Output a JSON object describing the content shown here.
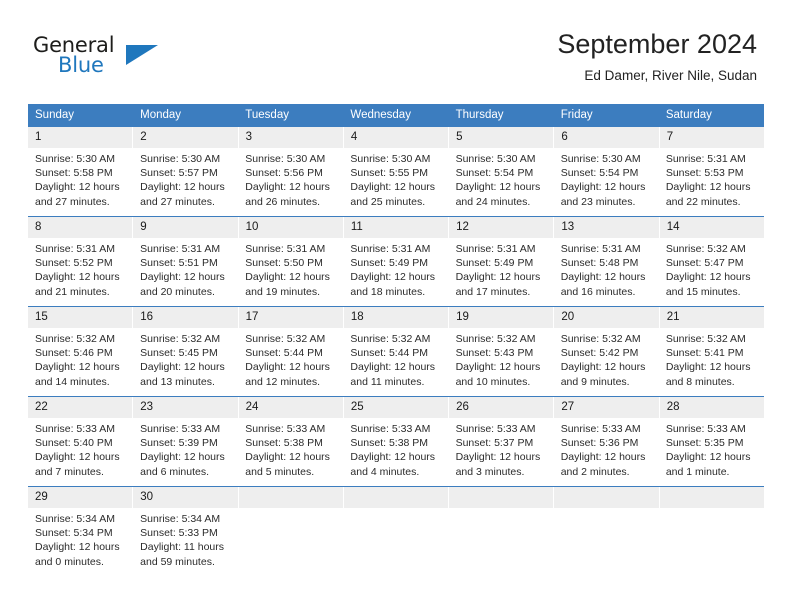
{
  "logo": {
    "word1": "General",
    "word2": "Blue",
    "triangle_color": "#1f77bd"
  },
  "header": {
    "title": "September 2024",
    "subtitle": "Ed Damer, River Nile, Sudan"
  },
  "theme": {
    "header_blue": "#3c7dbf",
    "daynum_band": "#eeeeee",
    "text": "#1a1a1a"
  },
  "weekdays": [
    "Sunday",
    "Monday",
    "Tuesday",
    "Wednesday",
    "Thursday",
    "Friday",
    "Saturday"
  ],
  "weeks": [
    {
      "days": [
        {
          "num": "1",
          "sunrise": "Sunrise: 5:30 AM",
          "sunset": "Sunset: 5:58 PM",
          "daylight1": "Daylight: 12 hours",
          "daylight2": "and 27 minutes."
        },
        {
          "num": "2",
          "sunrise": "Sunrise: 5:30 AM",
          "sunset": "Sunset: 5:57 PM",
          "daylight1": "Daylight: 12 hours",
          "daylight2": "and 27 minutes."
        },
        {
          "num": "3",
          "sunrise": "Sunrise: 5:30 AM",
          "sunset": "Sunset: 5:56 PM",
          "daylight1": "Daylight: 12 hours",
          "daylight2": "and 26 minutes."
        },
        {
          "num": "4",
          "sunrise": "Sunrise: 5:30 AM",
          "sunset": "Sunset: 5:55 PM",
          "daylight1": "Daylight: 12 hours",
          "daylight2": "and 25 minutes."
        },
        {
          "num": "5",
          "sunrise": "Sunrise: 5:30 AM",
          "sunset": "Sunset: 5:54 PM",
          "daylight1": "Daylight: 12 hours",
          "daylight2": "and 24 minutes."
        },
        {
          "num": "6",
          "sunrise": "Sunrise: 5:30 AM",
          "sunset": "Sunset: 5:54 PM",
          "daylight1": "Daylight: 12 hours",
          "daylight2": "and 23 minutes."
        },
        {
          "num": "7",
          "sunrise": "Sunrise: 5:31 AM",
          "sunset": "Sunset: 5:53 PM",
          "daylight1": "Daylight: 12 hours",
          "daylight2": "and 22 minutes."
        }
      ]
    },
    {
      "days": [
        {
          "num": "8",
          "sunrise": "Sunrise: 5:31 AM",
          "sunset": "Sunset: 5:52 PM",
          "daylight1": "Daylight: 12 hours",
          "daylight2": "and 21 minutes."
        },
        {
          "num": "9",
          "sunrise": "Sunrise: 5:31 AM",
          "sunset": "Sunset: 5:51 PM",
          "daylight1": "Daylight: 12 hours",
          "daylight2": "and 20 minutes."
        },
        {
          "num": "10",
          "sunrise": "Sunrise: 5:31 AM",
          "sunset": "Sunset: 5:50 PM",
          "daylight1": "Daylight: 12 hours",
          "daylight2": "and 19 minutes."
        },
        {
          "num": "11",
          "sunrise": "Sunrise: 5:31 AM",
          "sunset": "Sunset: 5:49 PM",
          "daylight1": "Daylight: 12 hours",
          "daylight2": "and 18 minutes."
        },
        {
          "num": "12",
          "sunrise": "Sunrise: 5:31 AM",
          "sunset": "Sunset: 5:49 PM",
          "daylight1": "Daylight: 12 hours",
          "daylight2": "and 17 minutes."
        },
        {
          "num": "13",
          "sunrise": "Sunrise: 5:31 AM",
          "sunset": "Sunset: 5:48 PM",
          "daylight1": "Daylight: 12 hours",
          "daylight2": "and 16 minutes."
        },
        {
          "num": "14",
          "sunrise": "Sunrise: 5:32 AM",
          "sunset": "Sunset: 5:47 PM",
          "daylight1": "Daylight: 12 hours",
          "daylight2": "and 15 minutes."
        }
      ]
    },
    {
      "days": [
        {
          "num": "15",
          "sunrise": "Sunrise: 5:32 AM",
          "sunset": "Sunset: 5:46 PM",
          "daylight1": "Daylight: 12 hours",
          "daylight2": "and 14 minutes."
        },
        {
          "num": "16",
          "sunrise": "Sunrise: 5:32 AM",
          "sunset": "Sunset: 5:45 PM",
          "daylight1": "Daylight: 12 hours",
          "daylight2": "and 13 minutes."
        },
        {
          "num": "17",
          "sunrise": "Sunrise: 5:32 AM",
          "sunset": "Sunset: 5:44 PM",
          "daylight1": "Daylight: 12 hours",
          "daylight2": "and 12 minutes."
        },
        {
          "num": "18",
          "sunrise": "Sunrise: 5:32 AM",
          "sunset": "Sunset: 5:44 PM",
          "daylight1": "Daylight: 12 hours",
          "daylight2": "and 11 minutes."
        },
        {
          "num": "19",
          "sunrise": "Sunrise: 5:32 AM",
          "sunset": "Sunset: 5:43 PM",
          "daylight1": "Daylight: 12 hours",
          "daylight2": "and 10 minutes."
        },
        {
          "num": "20",
          "sunrise": "Sunrise: 5:32 AM",
          "sunset": "Sunset: 5:42 PM",
          "daylight1": "Daylight: 12 hours",
          "daylight2": "and 9 minutes."
        },
        {
          "num": "21",
          "sunrise": "Sunrise: 5:32 AM",
          "sunset": "Sunset: 5:41 PM",
          "daylight1": "Daylight: 12 hours",
          "daylight2": "and 8 minutes."
        }
      ]
    },
    {
      "days": [
        {
          "num": "22",
          "sunrise": "Sunrise: 5:33 AM",
          "sunset": "Sunset: 5:40 PM",
          "daylight1": "Daylight: 12 hours",
          "daylight2": "and 7 minutes."
        },
        {
          "num": "23",
          "sunrise": "Sunrise: 5:33 AM",
          "sunset": "Sunset: 5:39 PM",
          "daylight1": "Daylight: 12 hours",
          "daylight2": "and 6 minutes."
        },
        {
          "num": "24",
          "sunrise": "Sunrise: 5:33 AM",
          "sunset": "Sunset: 5:38 PM",
          "daylight1": "Daylight: 12 hours",
          "daylight2": "and 5 minutes."
        },
        {
          "num": "25",
          "sunrise": "Sunrise: 5:33 AM",
          "sunset": "Sunset: 5:38 PM",
          "daylight1": "Daylight: 12 hours",
          "daylight2": "and 4 minutes."
        },
        {
          "num": "26",
          "sunrise": "Sunrise: 5:33 AM",
          "sunset": "Sunset: 5:37 PM",
          "daylight1": "Daylight: 12 hours",
          "daylight2": "and 3 minutes."
        },
        {
          "num": "27",
          "sunrise": "Sunrise: 5:33 AM",
          "sunset": "Sunset: 5:36 PM",
          "daylight1": "Daylight: 12 hours",
          "daylight2": "and 2 minutes."
        },
        {
          "num": "28",
          "sunrise": "Sunrise: 5:33 AM",
          "sunset": "Sunset: 5:35 PM",
          "daylight1": "Daylight: 12 hours",
          "daylight2": "and 1 minute."
        }
      ]
    },
    {
      "days": [
        {
          "num": "29",
          "sunrise": "Sunrise: 5:34 AM",
          "sunset": "Sunset: 5:34 PM",
          "daylight1": "Daylight: 12 hours",
          "daylight2": "and 0 minutes."
        },
        {
          "num": "30",
          "sunrise": "Sunrise: 5:34 AM",
          "sunset": "Sunset: 5:33 PM",
          "daylight1": "Daylight: 11 hours",
          "daylight2": "and 59 minutes."
        },
        {
          "num": "",
          "sunrise": "",
          "sunset": "",
          "daylight1": "",
          "daylight2": ""
        },
        {
          "num": "",
          "sunrise": "",
          "sunset": "",
          "daylight1": "",
          "daylight2": ""
        },
        {
          "num": "",
          "sunrise": "",
          "sunset": "",
          "daylight1": "",
          "daylight2": ""
        },
        {
          "num": "",
          "sunrise": "",
          "sunset": "",
          "daylight1": "",
          "daylight2": ""
        },
        {
          "num": "",
          "sunrise": "",
          "sunset": "",
          "daylight1": "",
          "daylight2": ""
        }
      ]
    }
  ]
}
